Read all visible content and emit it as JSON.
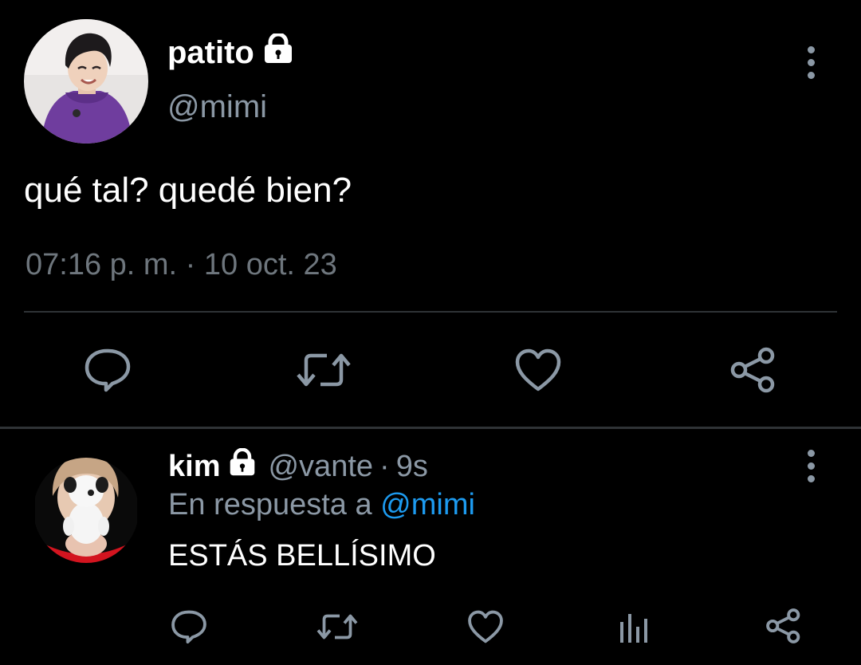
{
  "tweet": {
    "author_name": "patito",
    "author_handle": "@mimi",
    "text": "qué tal? quedé bien?",
    "timestamp": "07:16 p. m. · 10 oct. 23",
    "avatar": "user-avatar-photo",
    "locked_icon": "lock-icon",
    "more_icon": "more-options-icon",
    "actions": [
      "reply-icon",
      "retweet-icon",
      "like-icon",
      "share-icon"
    ]
  },
  "reply": {
    "author_name": "kim",
    "author_handle": "@vante",
    "separator": "·",
    "age": "9s",
    "replying_prefix": "En respuesta a",
    "replying_to": "@mimi",
    "text": "ESTÁS BELLÍSIMO",
    "avatar": "user-avatar-photo",
    "locked_icon": "lock-icon",
    "more_icon": "more-options-icon",
    "actions": [
      "reply-icon",
      "retweet-icon",
      "like-icon",
      "analytics-icon",
      "share-icon"
    ]
  },
  "colors": {
    "background": "#000000",
    "primary_text": "#ffffff",
    "secondary_text": "#8b98a5",
    "link": "#1d9bf0",
    "divider": "#2f3336",
    "icon": "#8b98a5"
  }
}
